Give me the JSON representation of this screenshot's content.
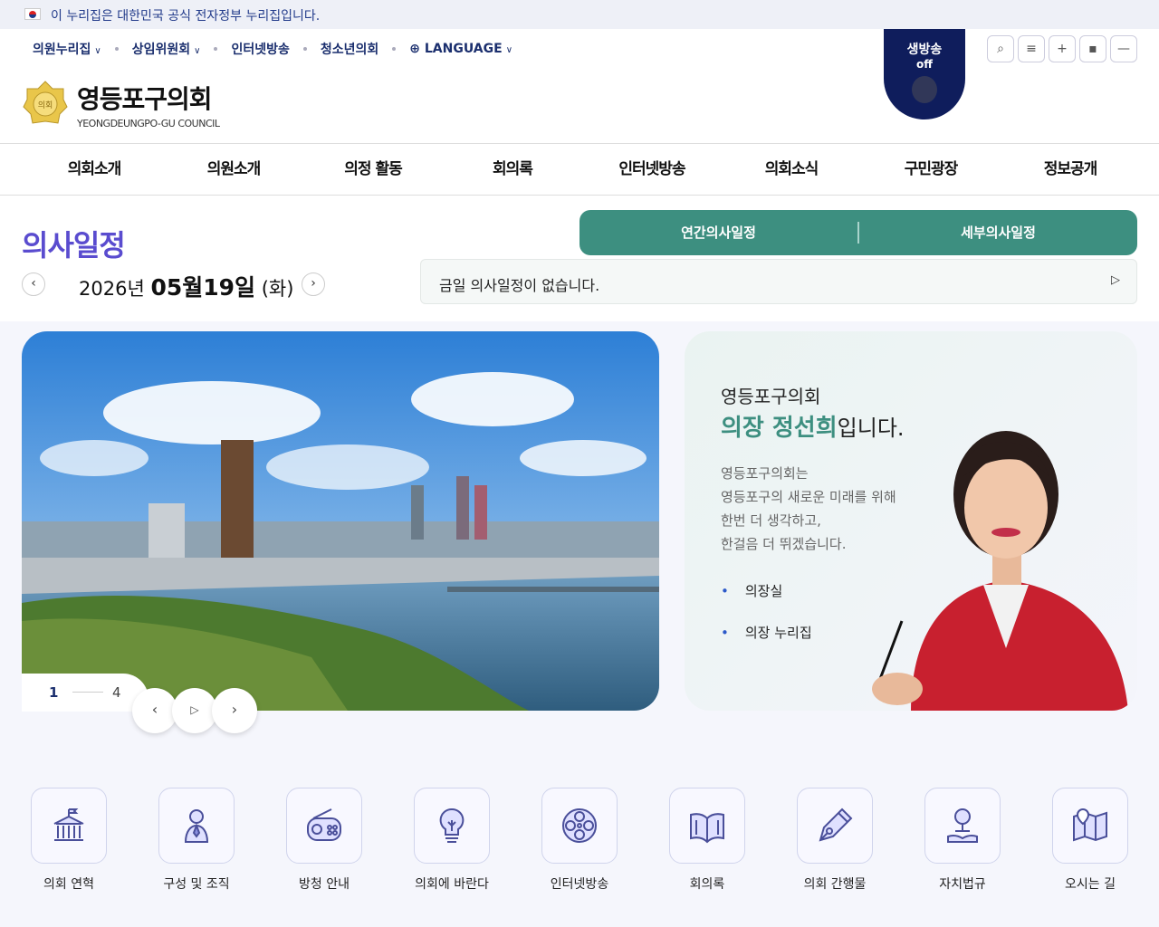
{
  "gov_banner": "이 누리집은 대한민국 공식 전자정부 누리집입니다.",
  "util_nav": [
    "의원누리집",
    "상임위원회",
    "인터넷방송",
    "청소년의회",
    "LANGUAGE"
  ],
  "brand": {
    "name_ko": "영등포구의회",
    "name_en": "YEONGDEUNGPO-GU COUNCIL",
    "logo_text": "의회"
  },
  "live": {
    "label": "생방송",
    "status": "off"
  },
  "tools": [
    "search-icon",
    "menu-icon",
    "zoom-in-icon",
    "reset-icon",
    "zoom-out-icon"
  ],
  "gnb": [
    "의회소개",
    "의원소개",
    "의정 활동",
    "회의록",
    "인터넷방송",
    "의회소식",
    "구민광장",
    "정보공개"
  ],
  "schedule": {
    "title": "의사일정",
    "date_year": "2026년",
    "date_md": "05월19일",
    "date_dow": "(화)",
    "tabs": [
      "연간의사일정",
      "세부의사일정"
    ],
    "notice": "금일 의사일정이 없습니다."
  },
  "slider": {
    "current": "1",
    "total": "4"
  },
  "greeting": {
    "line1": "영등포구의회",
    "name": "의장 정선희",
    "suffix": "입니다.",
    "body": [
      "영등포구의회는",
      "영등포구의 새로운 미래를 위해",
      "한번 더 생각하고,",
      "한걸음 더 뛰겠습니다."
    ],
    "links": [
      "의장실",
      "의장 누리집"
    ]
  },
  "quick": [
    {
      "label": "의회 연혁",
      "icon": "building-icon"
    },
    {
      "label": "구성 및 조직",
      "icon": "person-icon"
    },
    {
      "label": "방청 안내",
      "icon": "radio-icon"
    },
    {
      "label": "의회에 바란다",
      "icon": "lightbulb-icon"
    },
    {
      "label": "인터넷방송",
      "icon": "film-reel-icon"
    },
    {
      "label": "회의록",
      "icon": "book-icon"
    },
    {
      "label": "의회 간행물",
      "icon": "pen-icon"
    },
    {
      "label": "자치법규",
      "icon": "law-icon"
    },
    {
      "label": "오시는 길",
      "icon": "map-icon"
    }
  ],
  "colors": {
    "accent": "#3d8f80",
    "title": "#5a4ccf",
    "navy": "#0f1d5c"
  }
}
